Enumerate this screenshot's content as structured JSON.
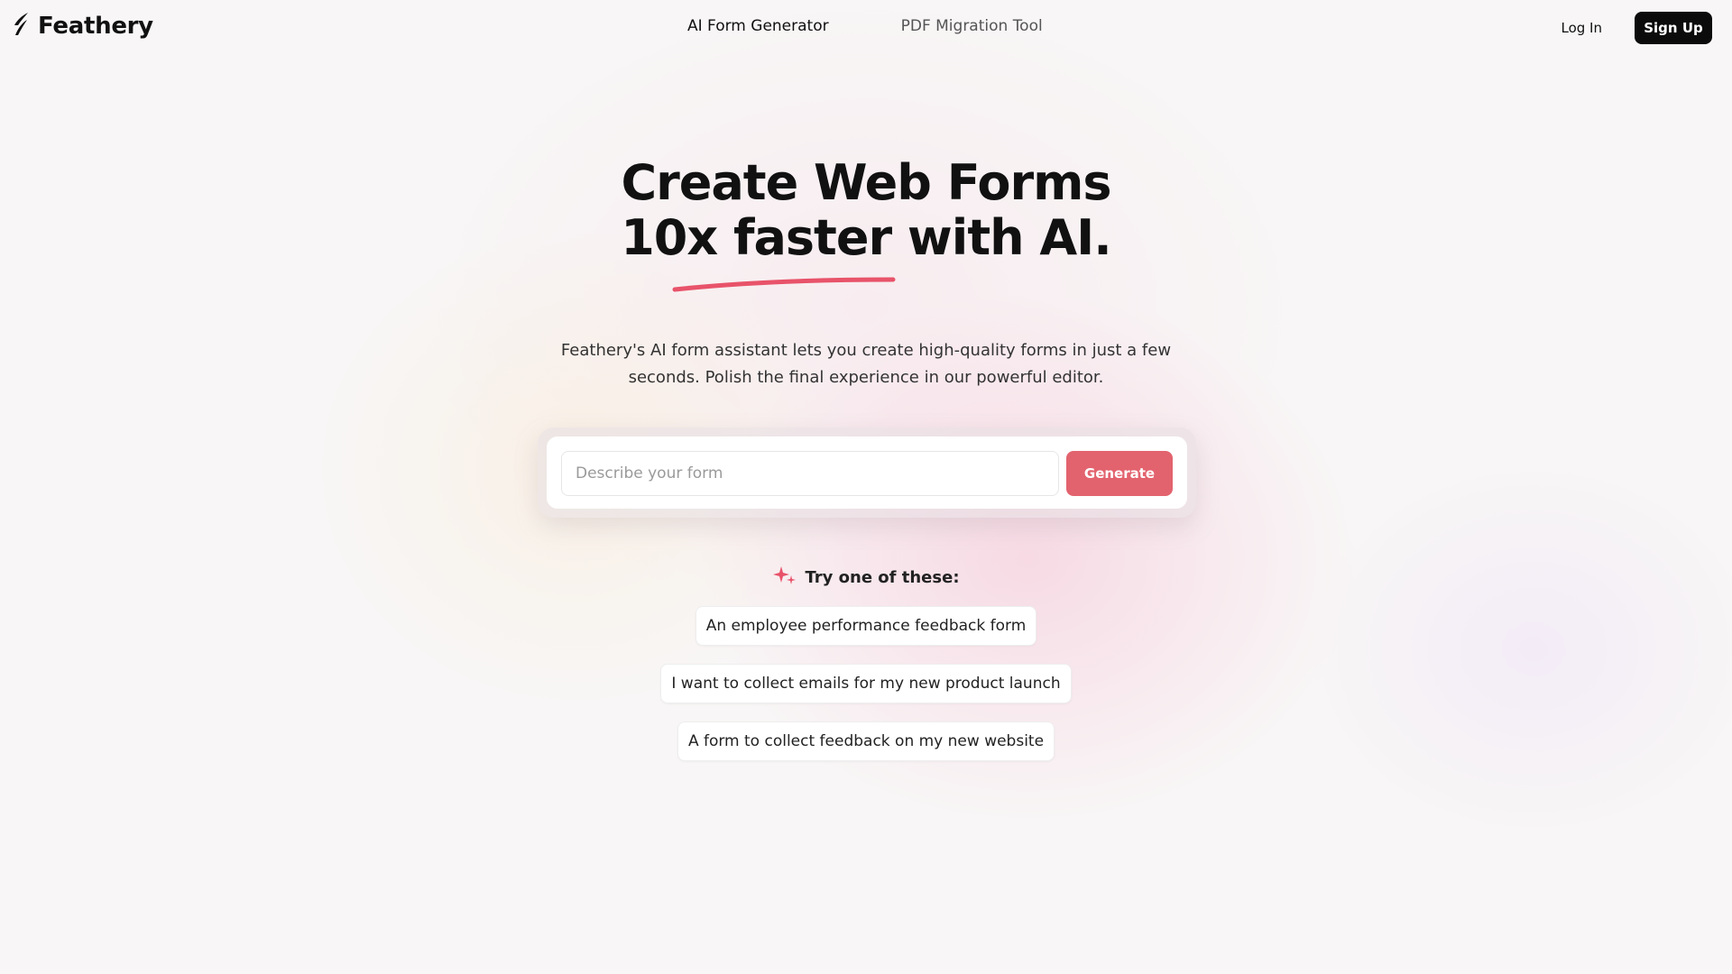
{
  "header": {
    "brand": "Feathery",
    "logo_icon": "feather-logo-icon",
    "nav": [
      {
        "label": "AI Form Generator",
        "active": true
      },
      {
        "label": "PDF Migration Tool",
        "active": false
      }
    ],
    "login_label": "Log In",
    "signup_label": "Sign Up"
  },
  "hero": {
    "title_line1": "Create Web Forms",
    "title_line2": "10x faster with AI.",
    "underline_color": "#e8536a",
    "subtitle_line1": "Feathery's AI form assistant lets you create high-quality forms in just a few",
    "subtitle_line2": "seconds. Polish the final experience in our powerful editor."
  },
  "prompt": {
    "placeholder": "Describe your form",
    "value": "",
    "generate_label": "Generate",
    "accent_color": "#e2636e"
  },
  "suggestions": {
    "icon": "sparkles-icon",
    "label": "Try one of these:",
    "items": [
      "An employee performance feedback form",
      "I want to collect emails for my new product launch",
      "A form to collect feedback on my new website"
    ]
  }
}
